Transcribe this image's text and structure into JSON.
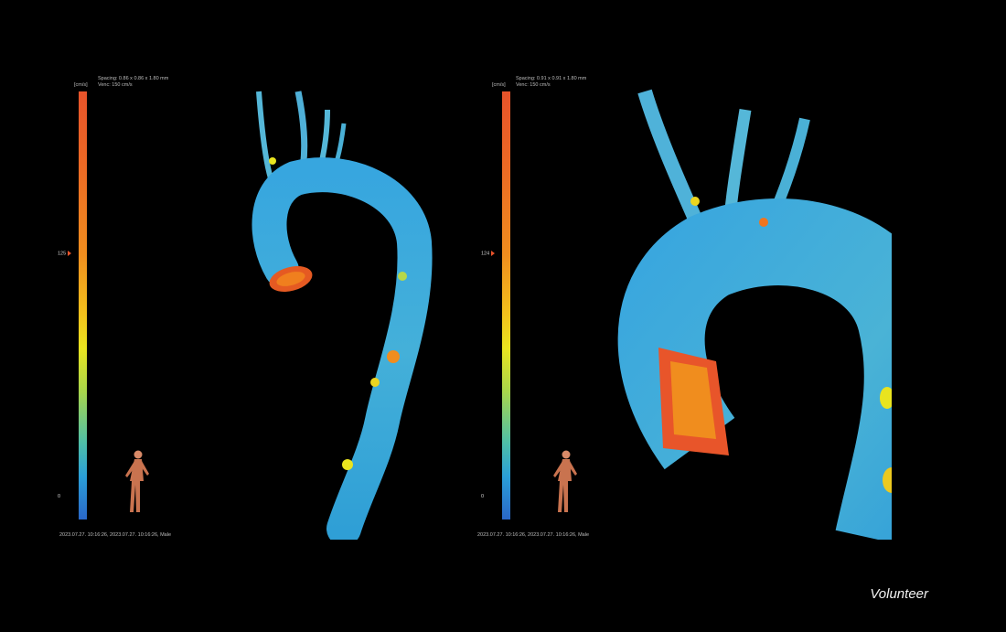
{
  "caption": "Volunteer",
  "panels": [
    {
      "unit": "[cm/s]",
      "spacing": "Spacing: 0.86 x 0.86 x 1.80 mm",
      "venc": "Venc: 150 cm/s",
      "colorbar_top": "",
      "colorbar_mid": "125",
      "colorbar_min": "0",
      "footer": "2023.07.27. 10:16:26, 2023.07.27. 10:16:26, Male"
    },
    {
      "unit": "[cm/s]",
      "spacing": "Spacing: 0.91 x 0.91 x 1.80 mm",
      "venc": "Venc: 150 cm/s",
      "colorbar_top": "",
      "colorbar_mid": "124",
      "colorbar_min": "0",
      "footer": "2023.07.27. 10:16:26, 2023.07.27. 10:16:26, Male"
    }
  ]
}
